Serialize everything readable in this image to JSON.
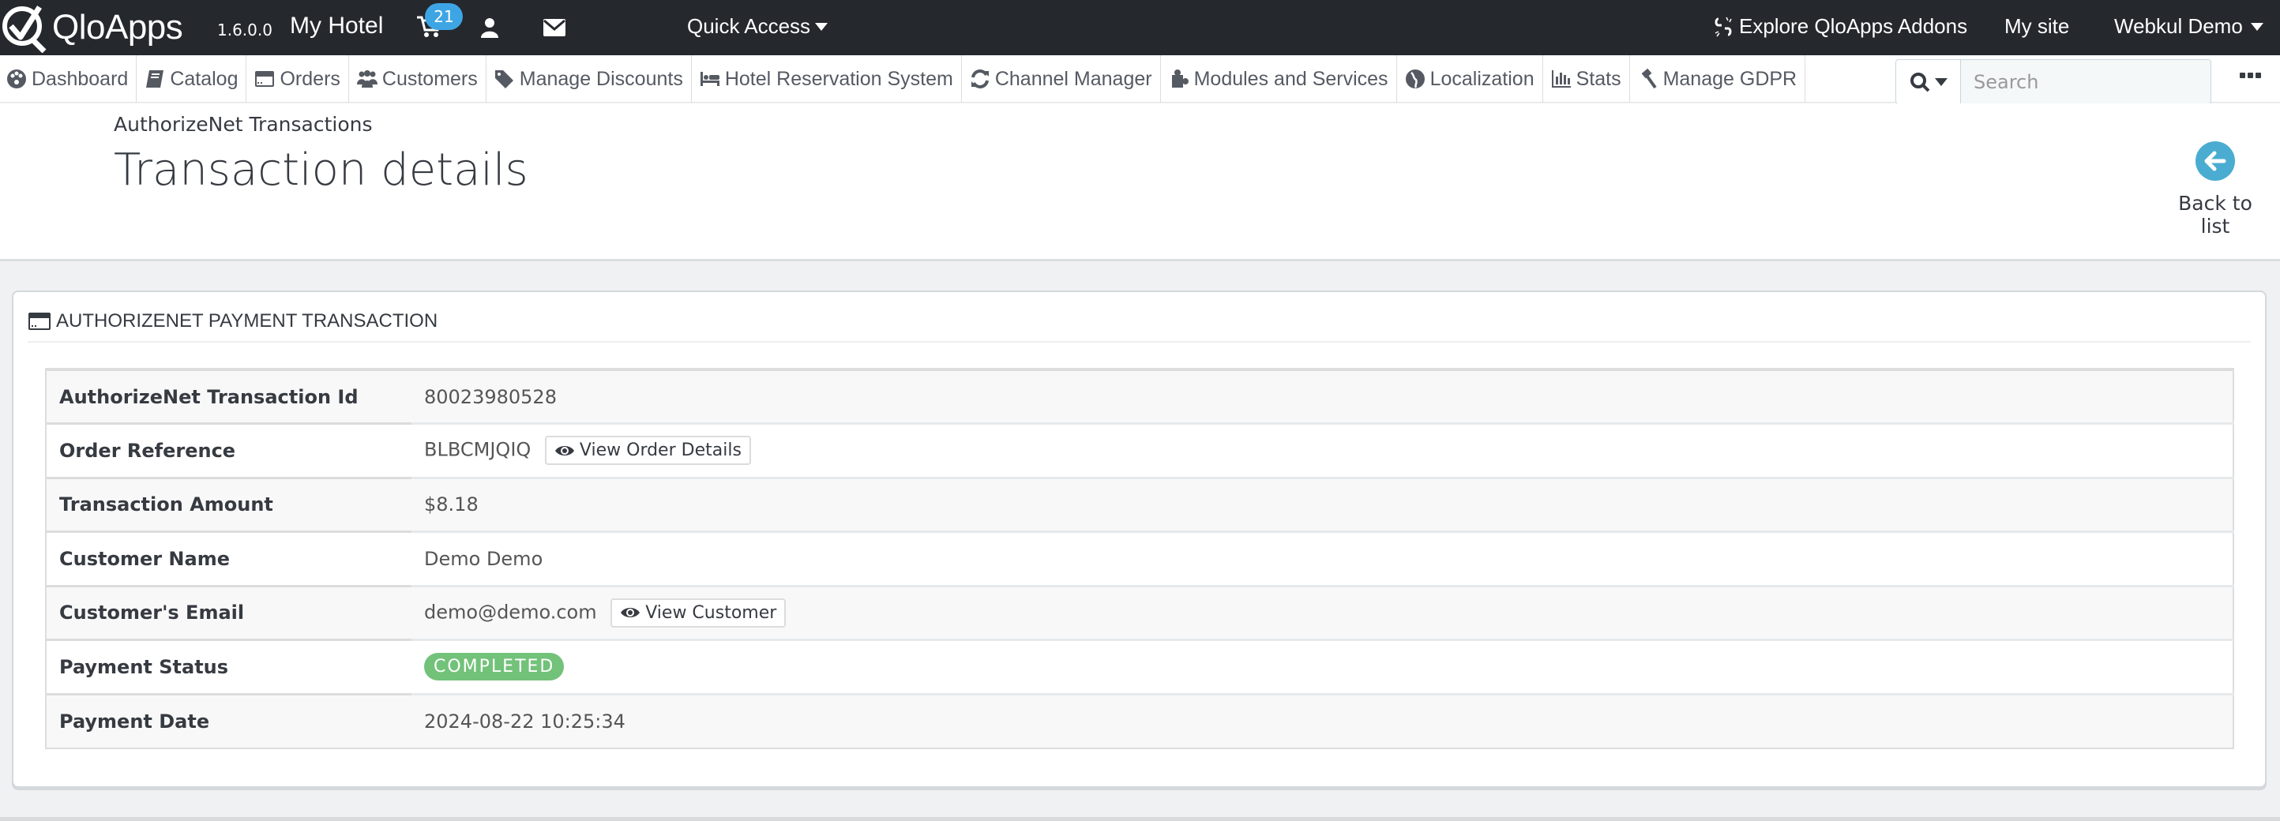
{
  "header": {
    "logo_text": "QloApps",
    "version": "1.6.0.0",
    "shop_name": "My Hotel",
    "cart_badge": "21",
    "quick_access": "Quick Access",
    "addons_link": "Explore QloApps Addons",
    "my_site": "My site",
    "employee_name": "Webkul Demo"
  },
  "nav": {
    "items": [
      {
        "label": "Dashboard",
        "icon": "dashboard-icon"
      },
      {
        "label": "Catalog",
        "icon": "book-icon"
      },
      {
        "label": "Orders",
        "icon": "credit-card-icon"
      },
      {
        "label": "Customers",
        "icon": "users-icon"
      },
      {
        "label": "Manage Discounts",
        "icon": "tags-icon"
      },
      {
        "label": "Hotel Reservation System",
        "icon": "bed-icon"
      },
      {
        "label": "Channel Manager",
        "icon": "refresh-icon"
      },
      {
        "label": "Modules and Services",
        "icon": "puzzle-icon"
      },
      {
        "label": "Localization",
        "icon": "globe-icon"
      },
      {
        "label": "Stats",
        "icon": "bar-chart-icon"
      },
      {
        "label": "Manage GDPR",
        "icon": "gavel-icon"
      }
    ],
    "search_placeholder": "Search"
  },
  "page": {
    "breadcrumb": "AuthorizeNet Transactions",
    "title": "Transaction details",
    "back_label": "Back to list"
  },
  "panel": {
    "heading": "AuthorizeNet Payment Transaction",
    "rows": [
      {
        "label": "AuthorizeNet Transaction Id",
        "value": "80023980528"
      },
      {
        "label": "Order Reference",
        "value": "BLBCMJQIQ",
        "button": "View Order Details"
      },
      {
        "label": "Transaction Amount",
        "value": "$8.18"
      },
      {
        "label": "Customer Name",
        "value": "Demo Demo"
      },
      {
        "label": "Customer's Email",
        "value": "demo@demo.com",
        "button": "View Customer"
      },
      {
        "label": "Payment Status",
        "badge": "COMPLETED",
        "badge_color": "#72c279"
      },
      {
        "label": "Payment Date",
        "value": "2024-08-22 10:25:34"
      }
    ]
  },
  "colors": {
    "header_bg": "#25282d",
    "accent_blue": "#4bacd1",
    "badge_blue": "#3ea5e5",
    "success_green": "#72c279"
  }
}
